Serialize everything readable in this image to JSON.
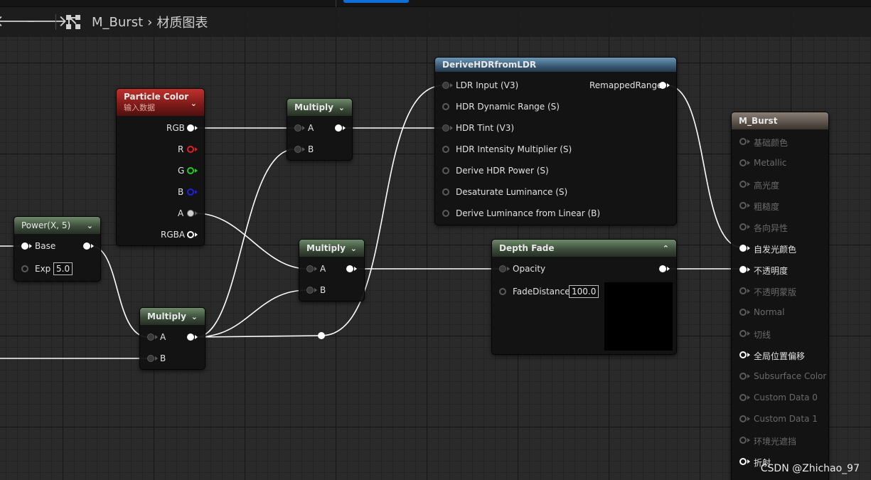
{
  "breadcrumb": {
    "asset": "M_Burst",
    "graph": "材质图表",
    "back_icon": "arrow-left-icon",
    "forward_icon": "arrow-right-icon",
    "graph_icon": "material-graph-icon"
  },
  "nodes": {
    "particle_color": {
      "title": "Particle Color",
      "subtitle": "输入数据",
      "outputs": [
        "RGB",
        "R",
        "G",
        "B",
        "A",
        "RGBA"
      ]
    },
    "power": {
      "title": "Power(X, 5)",
      "inputs": [
        "Base",
        "Exp"
      ],
      "exp_value": "5.0"
    },
    "multiply_1": {
      "title": "Multiply",
      "inputs": [
        "A",
        "B"
      ]
    },
    "multiply_2": {
      "title": "Multiply",
      "inputs": [
        "A",
        "B"
      ]
    },
    "multiply_3": {
      "title": "Multiply",
      "inputs": [
        "A",
        "B"
      ]
    },
    "derive_hdr": {
      "title": "DeriveHDRfromLDR",
      "inputs": [
        "LDR Input (V3)",
        "HDR Dynamic Range (S)",
        "HDR Tint (V3)",
        "HDR Intensity Multiplier (S)",
        "Derive HDR Power (S)",
        "Desaturate Luminance (S)",
        "Derive Luminance from Linear (B)"
      ],
      "output": "RemappedRange"
    },
    "depth_fade": {
      "title": "Depth Fade",
      "inputs": [
        "Opacity",
        "FadeDistance"
      ],
      "fade_distance_value": "100.0"
    },
    "material_output": {
      "title": "M_Burst",
      "inputs": [
        {
          "label": "基础颜色",
          "active": false
        },
        {
          "label": "Metallic",
          "active": false
        },
        {
          "label": "高光度",
          "active": false
        },
        {
          "label": "粗糙度",
          "active": false
        },
        {
          "label": "各向异性",
          "active": false
        },
        {
          "label": "自发光颜色",
          "active": true
        },
        {
          "label": "不透明度",
          "active": true
        },
        {
          "label": "不透明蒙版",
          "active": false
        },
        {
          "label": "Normal",
          "active": false
        },
        {
          "label": "切线",
          "active": false
        },
        {
          "label": "全局位置偏移",
          "active": true
        },
        {
          "label": "Subsurface Color",
          "active": false
        },
        {
          "label": "Custom Data 0",
          "active": false
        },
        {
          "label": "Custom Data 1",
          "active": false
        },
        {
          "label": "环境光遮挡",
          "active": false
        },
        {
          "label": "折射",
          "active": true
        }
      ]
    }
  },
  "watermark": "CSDN @Zhichao_97",
  "colors": {
    "accent_tab": "#0d6fd6",
    "header_green": "#3a4a38",
    "header_blue": "#3a5a74",
    "header_red": "#7a1a18",
    "header_brown": "#5a524a",
    "wire": "#ffffff"
  }
}
